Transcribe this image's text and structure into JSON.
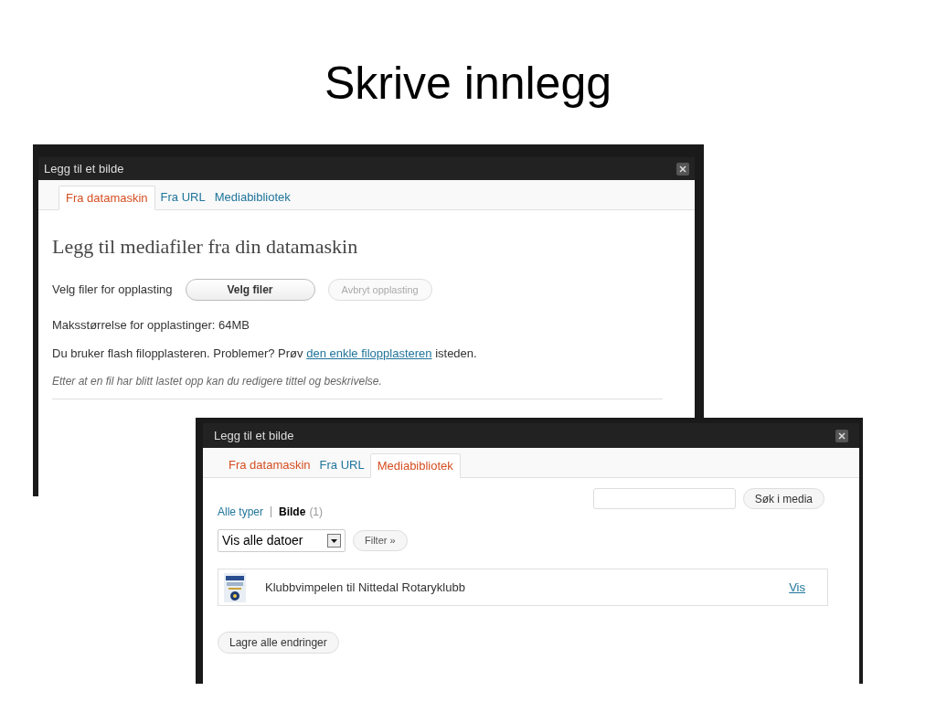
{
  "slide_title": "Skrive innlegg",
  "upload_dialog": {
    "title": "Legg til et bilde",
    "tabs": [
      {
        "label": "Fra datamaskin",
        "selected": true
      },
      {
        "label": "Fra URL",
        "selected": false
      },
      {
        "label": "Mediabibliotek",
        "selected": false
      }
    ],
    "heading": "Legg til mediafiler fra din datamaskin",
    "upload_label": "Velg filer for opplasting",
    "choose_button": {
      "label": "Velg filer",
      "disabled": false
    },
    "cancel_button": {
      "label": "Avbryt opplasting",
      "disabled": true
    },
    "max_size": "Maksstørrelse for opplastinger: 64MB",
    "flash_note": {
      "before": "Du bruker flash filopplasteren. Problemer? Prøv",
      "link": "den enkle filopplasteren",
      "after": "isteden."
    },
    "hint": "Etter at en fil har blitt lastet opp kan du redigere tittel og beskrivelse."
  },
  "library_dialog": {
    "title": "Legg til et bilde",
    "tabs": [
      {
        "label": "Fra datamaskin",
        "selected": false
      },
      {
        "label": "Fra URL",
        "selected": false
      },
      {
        "label": "Mediabibliotek",
        "selected": true
      }
    ],
    "search_button": "Søk i media",
    "type_filters": [
      {
        "label": "Alle typer",
        "selected": false
      },
      {
        "label": "Bilde",
        "count": "(1)",
        "selected": true
      }
    ],
    "date_select": "Vis alle datoer",
    "filter_button": "Filter »",
    "items": [
      {
        "title": "Klubbvimpelen til Nittedal Rotaryklubb",
        "action": "Vis"
      }
    ],
    "save_button": "Lagre alle endringer"
  }
}
